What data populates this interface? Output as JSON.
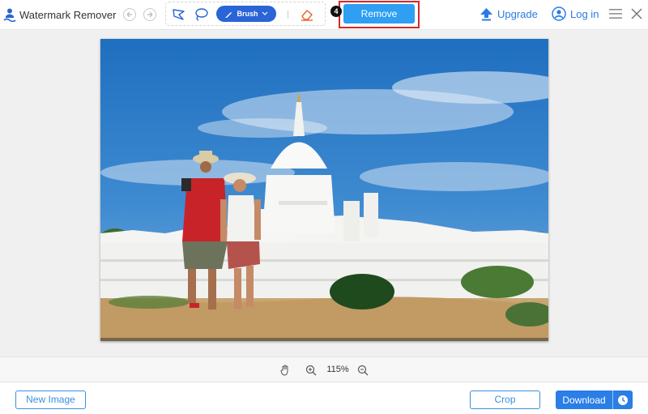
{
  "app": {
    "title": "Watermark Remover"
  },
  "toolbar": {
    "brush_label": "Brush",
    "remove_label": "Remove",
    "step_number": "4",
    "highlight_color": "#d92626",
    "accent_color": "#2e9ff2"
  },
  "header_right": {
    "upgrade_label": "Upgrade",
    "login_label": "Log in"
  },
  "zoom": {
    "level": "115%"
  },
  "footer": {
    "new_image_label": "New Image",
    "crop_label": "Crop",
    "download_label": "Download"
  },
  "icons": {
    "logo": "watermark-remover-logo-icon",
    "undo": "undo-icon",
    "redo": "redo-icon",
    "polygon": "polygon-lasso-icon",
    "lasso": "lasso-icon",
    "brush": "brush-icon",
    "eraser": "eraser-icon",
    "upgrade": "upgrade-arrow-icon",
    "login": "user-icon",
    "menu": "menu-icon",
    "close": "close-icon",
    "hand": "hand-icon",
    "zoom_in": "zoom-in-icon",
    "zoom_out": "zoom-out-icon",
    "clock": "clock-icon"
  },
  "image": {
    "description_visible": false
  }
}
